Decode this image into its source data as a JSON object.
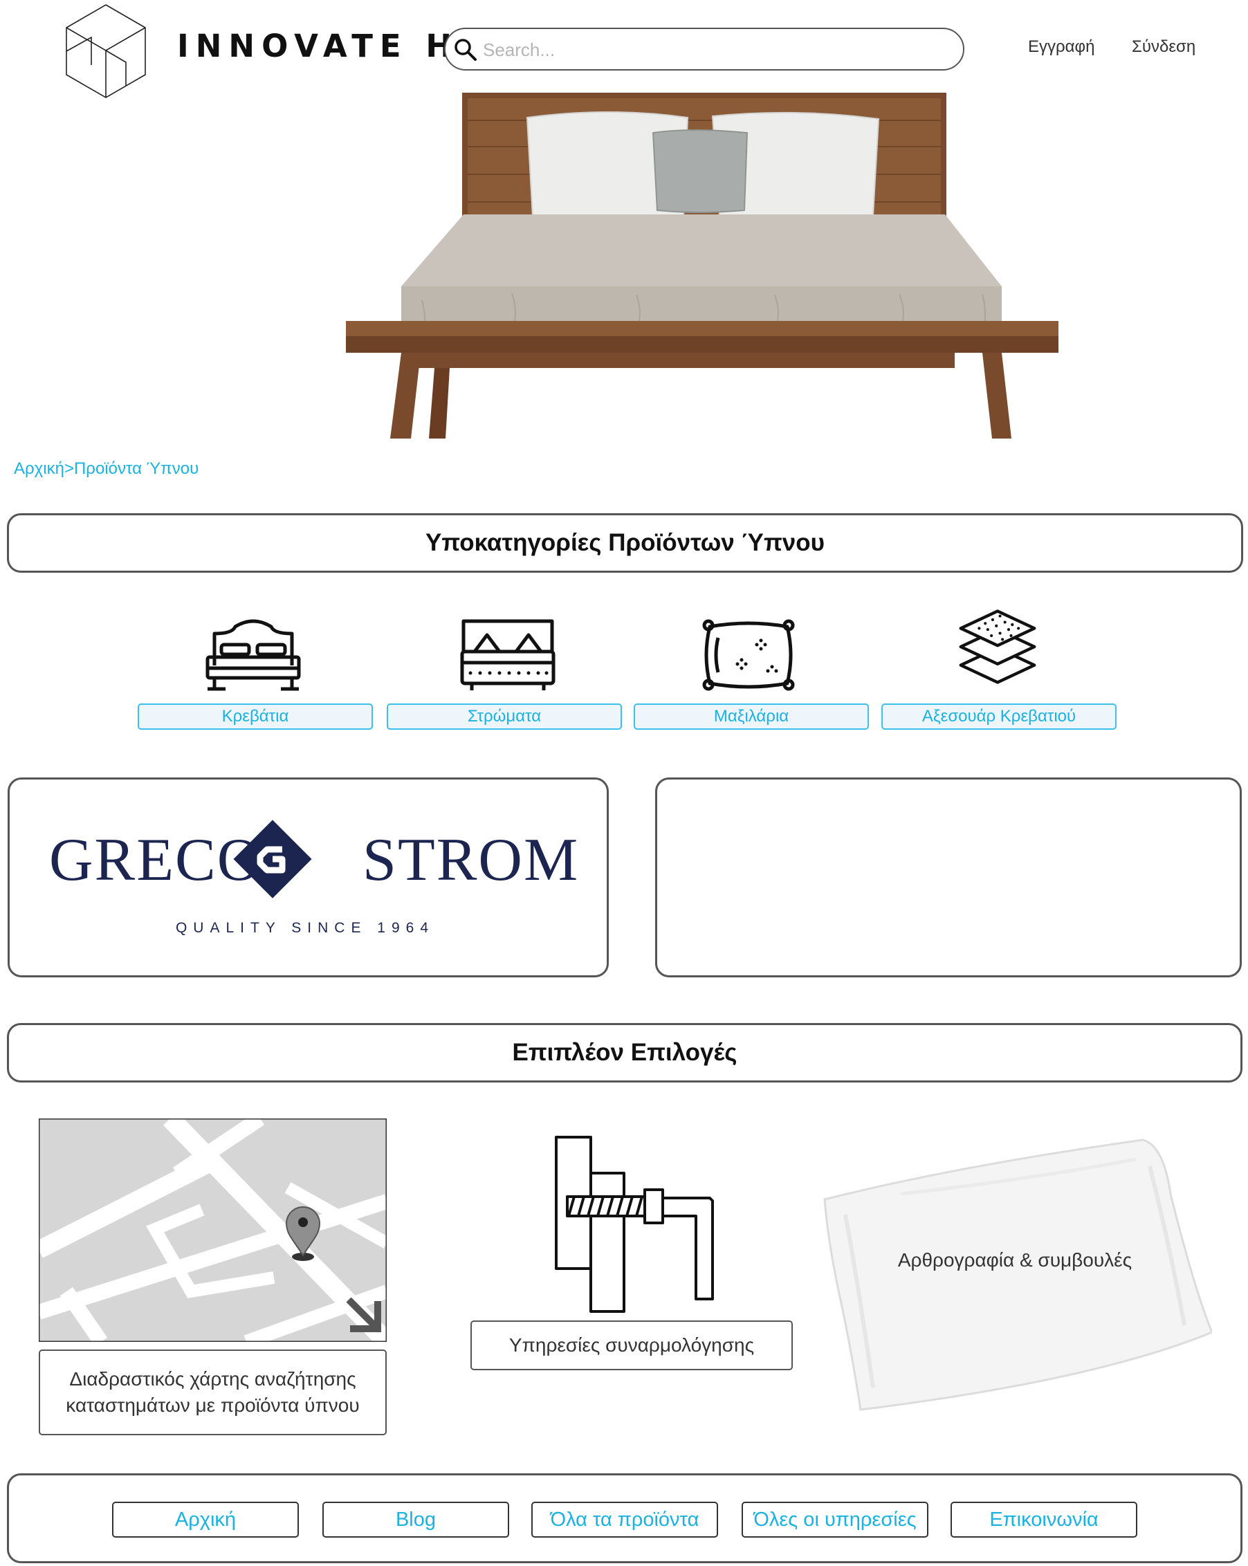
{
  "header": {
    "brand": "INNOVATE HOME",
    "search_placeholder": "Search...",
    "register_label": "Εγγραφή",
    "login_label": "Σύνδεση"
  },
  "breadcrumb": {
    "home": "Αρχική",
    "separator": ">",
    "current": "Προϊόντα Ύπνου"
  },
  "subcategories": {
    "title": "Υποκατηγορίες Προϊόντων Ύπνου",
    "items": [
      {
        "label": "Κρεβάτια",
        "icon": "bed-icon"
      },
      {
        "label": "Στρώματα",
        "icon": "mattress-icon"
      },
      {
        "label": "Μαξιλάρια",
        "icon": "pillow-icon"
      },
      {
        "label": "Αξεσουάρ Κρεβατιού",
        "icon": "bed-accessories-icon"
      }
    ]
  },
  "brand_banner": {
    "name_left": "GRECO",
    "name_right": "STROM",
    "tagline": "QUALITY SINCE 1964",
    "color": "#1b2550"
  },
  "more_options": {
    "title": "Επιπλέον Επιλογές",
    "map_label": "Διαδραστικός χάρτης αναζήτησης καταστημάτων με προϊόντα ύπνου",
    "assembly_label": "Υπηρεσίες συναρμολόγησης",
    "articles_label": "Αρθρογραφία & συμβουλές"
  },
  "footer": {
    "links": [
      "Αρχική",
      "Blog",
      "Όλα τα προϊόντα",
      "Όλες οι υπηρεσίες",
      "Επικοινωνία"
    ]
  },
  "colors": {
    "accent": "#1ab2e0",
    "border": "#555555",
    "button_bg": "#eef6fc"
  }
}
